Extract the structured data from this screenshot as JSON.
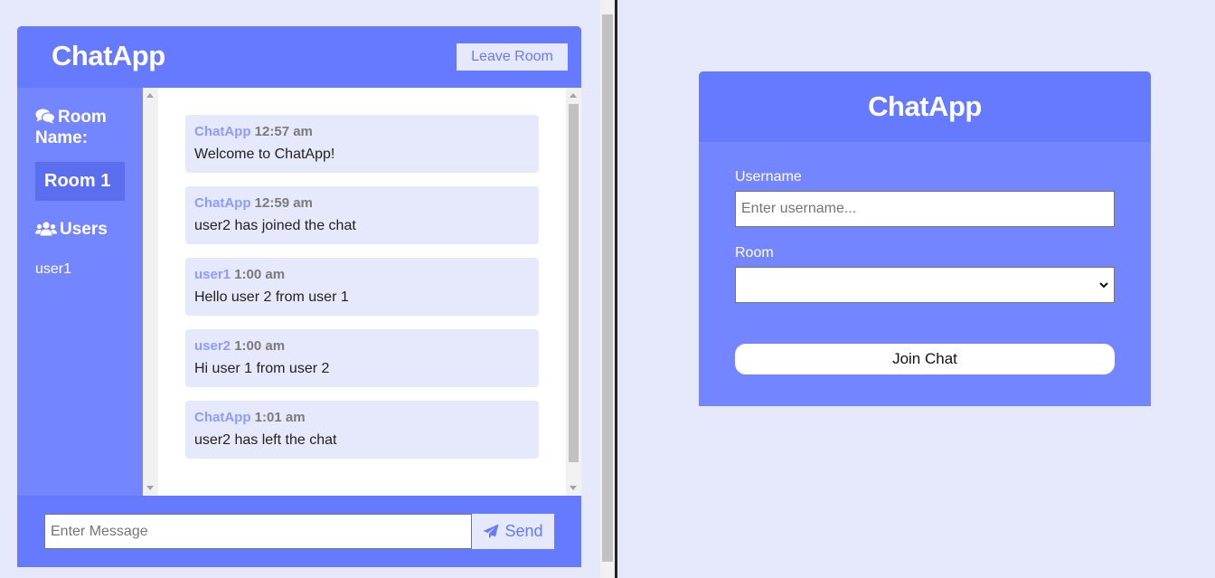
{
  "app": {
    "title": "ChatApp"
  },
  "chat": {
    "leave_label": "Leave Room",
    "room_heading": "Room Name:",
    "room_name": "Room 1",
    "users_heading": "Users",
    "users": [
      "user1"
    ],
    "messages": [
      {
        "author": "ChatApp",
        "time": "12:57 am",
        "text": "Welcome to ChatApp!"
      },
      {
        "author": "ChatApp",
        "time": "12:59 am",
        "text": "user2 has joined the chat"
      },
      {
        "author": "user1",
        "time": "1:00 am",
        "text": "Hello user 2 from user 1"
      },
      {
        "author": "user2",
        "time": "1:00 am",
        "text": "Hi user 1 from user 2"
      },
      {
        "author": "ChatApp",
        "time": "1:01 am",
        "text": "user2 has left the chat"
      }
    ],
    "input_placeholder": "Enter Message",
    "send_label": "Send"
  },
  "join": {
    "title": "ChatApp",
    "username_label": "Username",
    "username_placeholder": "Enter username...",
    "room_label": "Room",
    "room_value": "",
    "join_label": "Join Chat"
  },
  "colors": {
    "primary": "#667aff",
    "secondary": "#7386ff",
    "light": "#e6e8fb",
    "room_highlight": "#5b6ef0"
  },
  "icons": {
    "room": "comments-icon",
    "users": "users-icon",
    "send": "paper-plane-icon"
  }
}
